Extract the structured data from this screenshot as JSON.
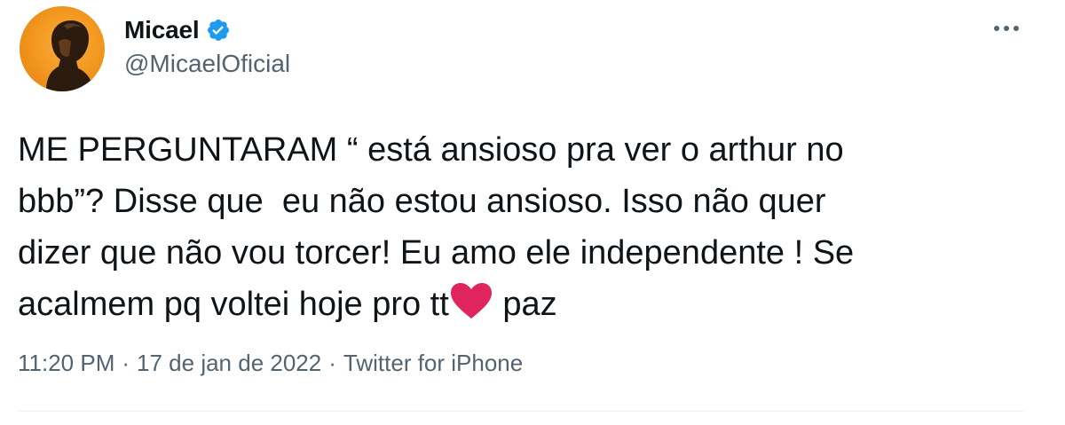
{
  "author": {
    "display_name": "Micael",
    "handle": "@MicaelOficial",
    "verified": true,
    "avatar_icon": "profile-photo-avatar",
    "verified_icon": "verified-badge-icon",
    "verified_color": "#1d9bf0"
  },
  "menu": {
    "icon": "more-options-icon"
  },
  "tweet": {
    "line1": "ME PERGUNTARAM “ está ansioso pra ver o arthur no",
    "line2": "bbb”? Disse que  eu não estou ansioso. Isso não quer",
    "line3": "dizer que não vou torcer! Eu amo ele independente ! Se",
    "line4_before": "acalmem pq voltei hoje pro tt",
    "line4_emoji": "red-heart-emoji",
    "line4_after": " paz",
    "heart_color": "#e0245e"
  },
  "meta": {
    "time": "11:20 PM",
    "date": "17 de jan de 2022",
    "source": "Twitter for iPhone",
    "separator": "·"
  },
  "colors": {
    "text": "#0f1419",
    "secondary": "#536471",
    "divider": "#eff3f4"
  }
}
